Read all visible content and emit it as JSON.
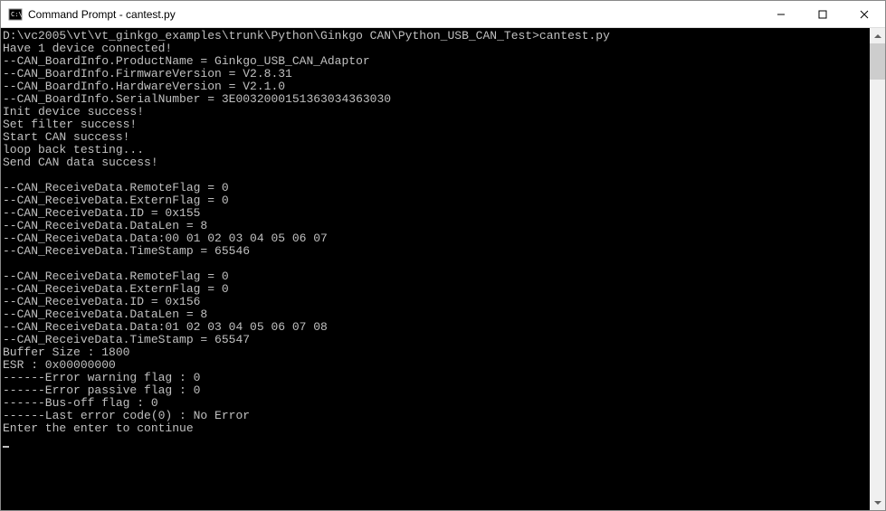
{
  "window": {
    "title": "Command Prompt - cantest.py"
  },
  "terminal": {
    "lines": [
      "D:\\vc2005\\vt\\vt_ginkgo_examples\\trunk\\Python\\Ginkgo CAN\\Python_USB_CAN_Test>cantest.py",
      "Have 1 device connected!",
      "--CAN_BoardInfo.ProductName = Ginkgo_USB_CAN_Adaptor",
      "--CAN_BoardInfo.FirmwareVersion = V2.8.31",
      "--CAN_BoardInfo.HardwareVersion = V2.1.0",
      "--CAN_BoardInfo.SerialNumber = 3E00320001513630343630​30",
      "Init device success!",
      "Set filter success!",
      "Start CAN success!",
      "loop back testing...",
      "Send CAN data success!",
      "",
      "--CAN_ReceiveData.RemoteFlag = 0",
      "--CAN_ReceiveData.ExternFlag = 0",
      "--CAN_ReceiveData.ID = 0x155",
      "--CAN_ReceiveData.DataLen = 8",
      "--CAN_ReceiveData.Data:00 01 02 03 04 05 06 07 ",
      "--CAN_ReceiveData.TimeStamp = 65546",
      "",
      "--CAN_ReceiveData.RemoteFlag = 0",
      "--CAN_ReceiveData.ExternFlag = 0",
      "--CAN_ReceiveData.ID = 0x156",
      "--CAN_ReceiveData.DataLen = 8",
      "--CAN_ReceiveData.Data:01 02 03 04 05 06 07 08 ",
      "--CAN_ReceiveData.TimeStamp = 65547",
      "Buffer Size : 1800",
      "ESR : 0x00000000",
      "------Error warning flag : 0",
      "------Error passive flag : 0",
      "------Bus-off flag : 0",
      "------Last error code(0) : No Error",
      "Enter the enter to continue"
    ]
  }
}
